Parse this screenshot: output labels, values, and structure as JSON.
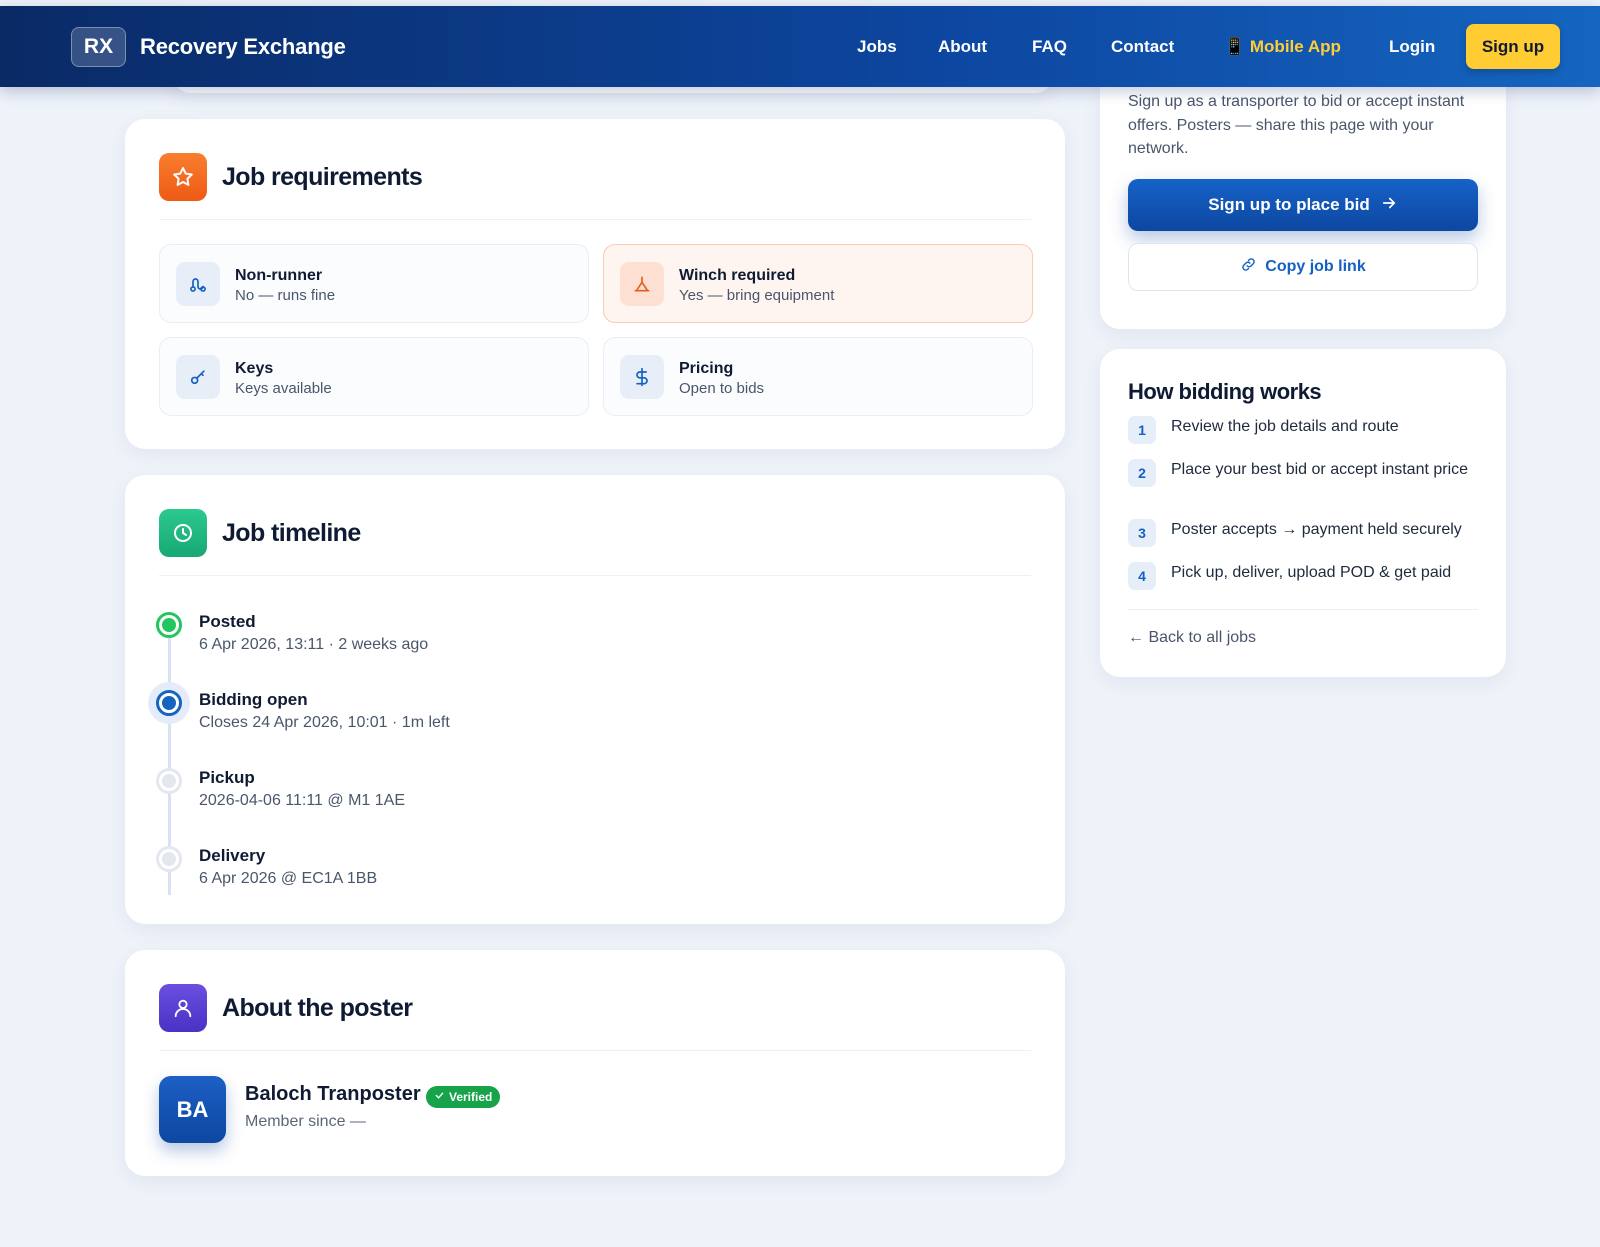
{
  "nav": {
    "logo_mark": "RX",
    "brand": "Recovery Exchange",
    "links": [
      "Jobs",
      "About",
      "FAQ",
      "Contact"
    ],
    "mobile_app": "📱 Mobile App",
    "login": "Login",
    "signup": "Sign up"
  },
  "requirements": {
    "title": "Job requirements",
    "items": [
      {
        "title": "Non-runner",
        "value": "No — runs fine",
        "icon": "route-icon"
      },
      {
        "title": "Winch required",
        "value": "Yes — bring equipment",
        "icon": "winch-icon",
        "highlight": true
      },
      {
        "title": "Keys",
        "value": "Keys available",
        "icon": "key-icon"
      },
      {
        "title": "Pricing",
        "value": "Open to bids",
        "icon": "dollar-icon"
      }
    ]
  },
  "timeline": {
    "title": "Job timeline",
    "items": [
      {
        "title": "Posted",
        "detail": "6 Apr 2026, 13:11 · 2 weeks ago",
        "status": "done"
      },
      {
        "title": "Bidding open",
        "detail": "Closes 24 Apr 2026, 10:01 · 1m left",
        "status": "active"
      },
      {
        "title": "Pickup",
        "detail": "2026-04-06 11:11 @ M1 1AE",
        "status": "pending"
      },
      {
        "title": "Delivery",
        "detail": "6 Apr 2026 @ EC1A 1BB",
        "status": "pending"
      }
    ]
  },
  "poster": {
    "title": "About the poster",
    "initials": "BA",
    "name": "Baloch Tranposter",
    "badge": "Verified",
    "member_since": "Member since —"
  },
  "sidebar": {
    "cta_text": "Sign up as a transporter to bid or accept instant offers. Posters — share this page with your network.",
    "bid_button": "Sign up to place bid",
    "copy_button": "Copy job link",
    "how_title": "How bidding works",
    "steps": [
      "Review the job details and route",
      "Place your best bid or accept instant price",
      "Poster accepts → payment held securely",
      "Pick up, deliver, upload POD & get paid"
    ],
    "back_link": "← Back to all jobs"
  },
  "colors": {
    "nav_start": "#0a2a66",
    "nav_end": "#1565c0",
    "accent_yellow": "#ffcc33",
    "primary_blue": "#0d47a1",
    "requirements_icon": "#f36c21",
    "timeline_icon": "#1fb87f",
    "poster_icon": "#5b3fd6",
    "verified_green": "#16a34a"
  }
}
